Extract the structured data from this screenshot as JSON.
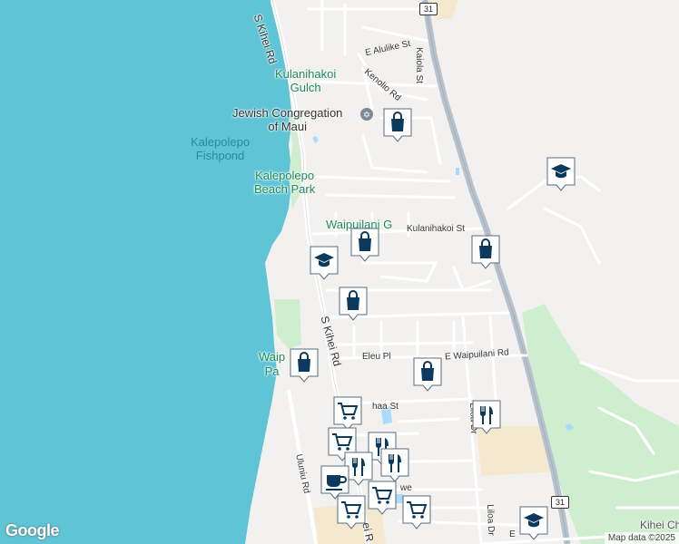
{
  "map": {
    "colors": {
      "ocean": "#5ec4d6",
      "land": "#f2f1ef",
      "park": "#cfeed0",
      "highway": "#b7c2cc",
      "road": "#ffffff",
      "marker": "#0c3a5e",
      "sand": "#f4e9cf"
    },
    "place_labels": {
      "kulanihakoi_gulch": "Kulanihakoi\nGulch",
      "jewish_congregation": "Jewish Congregation\nof Maui",
      "kalepolepo_fishpond": "Kalepolepo\nFishpond",
      "kalepolepo_beach_park": "Kalepolepo\nBeach Park",
      "waipuilani_gulch": "Waipuilani G",
      "waipuilani_park": "Waip\nPa",
      "kihei_ch": "Kihei Ch"
    },
    "road_labels": {
      "s_kihei_rd_top": "S Kihei Rd",
      "s_kihei_rd_mid": "S Kihei Rd",
      "s_kihei_rd_bottom": "ei R",
      "e_alulike_st": "E Alulike St",
      "kenolio_rd": "Kenolio Rd",
      "kaiola_st": "Kaiola St",
      "kulanihakoi_st": "Kulanihakoi St",
      "eleu_pl": "Eleu Pl",
      "e_waipuilani_rd": "E Waipuilani Rd",
      "ahaa_st": "haa St",
      "liloa_dr_upper": "Liloa Dr",
      "liloa_dr_lower": "Liloa Dr",
      "uluniu_rd": "Uluniu Rd",
      "we": "we",
      "e_label": "E"
    },
    "route_shields": {
      "top": "31",
      "bottom": "31"
    },
    "markers": [
      {
        "icon": "shopping-bag-icon"
      },
      {
        "icon": "school-icon"
      },
      {
        "icon": "school-icon"
      },
      {
        "icon": "shopping-bag-icon"
      },
      {
        "icon": "shopping-bag-icon"
      },
      {
        "icon": "shopping-bag-icon"
      },
      {
        "icon": "shopping-bag-icon"
      },
      {
        "icon": "shopping-bag-icon"
      },
      {
        "icon": "restaurant-icon"
      },
      {
        "icon": "shopping-cart-icon"
      },
      {
        "icon": "shopping-cart-icon"
      },
      {
        "icon": "restaurant-icon"
      },
      {
        "icon": "restaurant-icon"
      },
      {
        "icon": "restaurant-icon"
      },
      {
        "icon": "coffee-icon"
      },
      {
        "icon": "shopping-cart-icon"
      },
      {
        "icon": "shopping-cart-icon"
      },
      {
        "icon": "shopping-cart-icon"
      },
      {
        "icon": "school-icon"
      }
    ],
    "branding": "Google",
    "attribution": "Map data ©2025"
  }
}
